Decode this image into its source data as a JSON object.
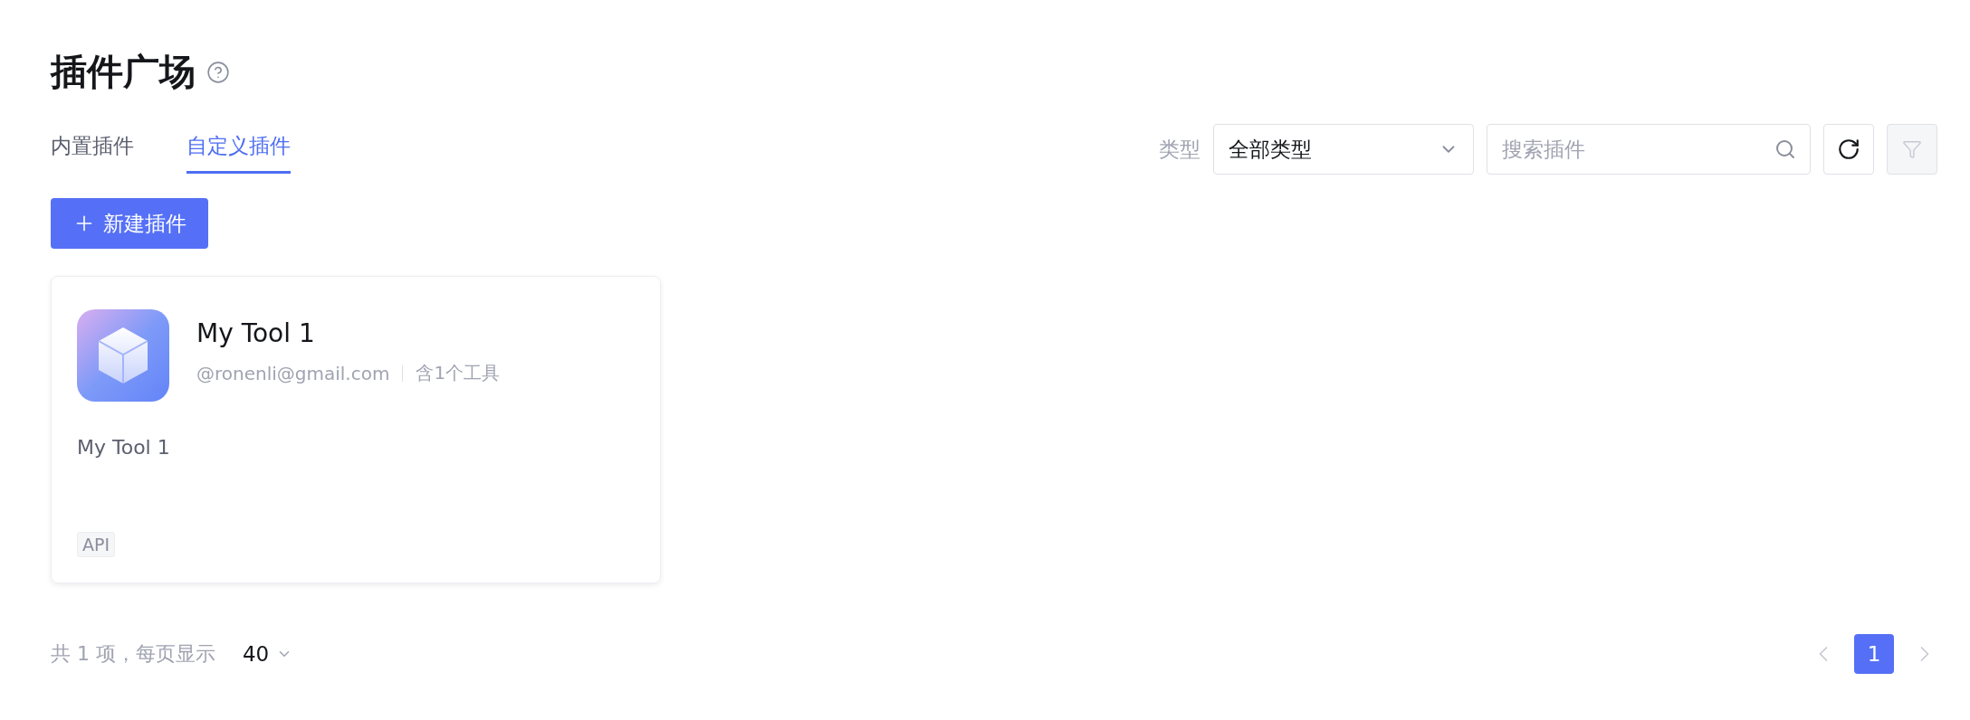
{
  "title": "插件广场",
  "tabs": [
    {
      "label": "内置插件",
      "selected": false
    },
    {
      "label": "自定义插件",
      "selected": true
    }
  ],
  "filter": {
    "label": "类型",
    "type_select": "全部类型",
    "search_placeholder": "搜索插件",
    "filter_disabled": true
  },
  "new_button": "新建插件",
  "plugins": [
    {
      "name": "My Tool 1",
      "author": "@ronenli@gmail.com",
      "tools": "含1个工具",
      "description": "My Tool 1",
      "tags": [
        "API"
      ]
    }
  ],
  "pagination": {
    "summary": "共 1 项，每页显示",
    "page_size": "40",
    "pages": [
      {
        "label": "1",
        "selected": true
      }
    ],
    "prev_disabled": true,
    "next_disabled": true
  }
}
